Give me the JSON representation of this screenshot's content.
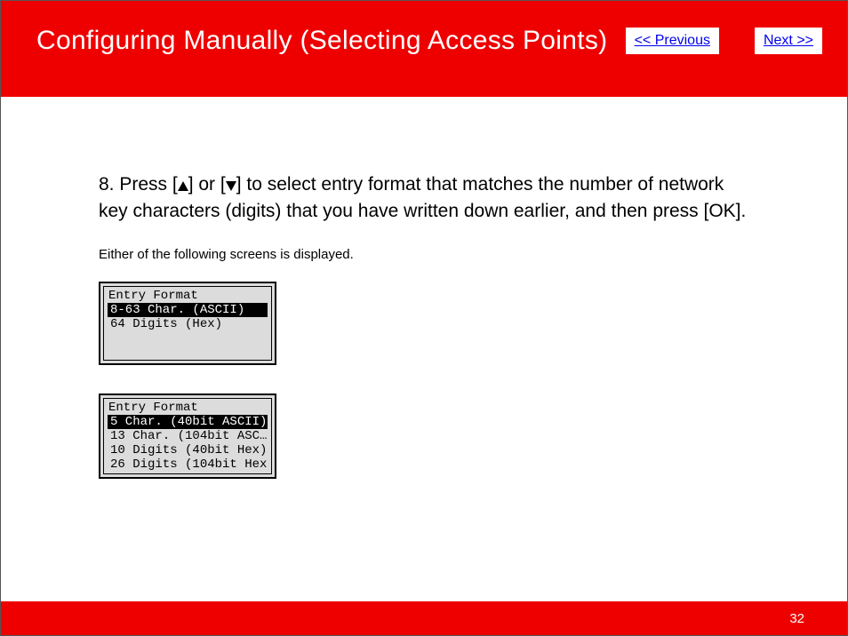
{
  "header": {
    "title": "Configuring Manually (Selecting Access Points)",
    "prev_label": "<< Previous",
    "next_label": "Next >>"
  },
  "step": {
    "number": "8.",
    "pre_arrow": " Press [",
    "mid1": "] or [",
    "mid2": "] to select entry format that matches the number of network key characters (digits) that you have written down earlier, and then press [OK]."
  },
  "note": "Either of the following screens is displayed.",
  "screens": [
    {
      "title": "Entry Format",
      "items": [
        {
          "label": "8-63 Char. (ASCII)",
          "selected": true
        },
        {
          "label": "64 Digits (Hex)",
          "selected": false
        }
      ]
    },
    {
      "title": "Entry Format",
      "items": [
        {
          "label": "5 Char. (40bit ASCII)",
          "selected": true
        },
        {
          "label": "13 Char. (104bit ASC…",
          "selected": false
        },
        {
          "label": "10 Digits (40bit Hex)",
          "selected": false
        },
        {
          "label": "26 Digits (104bit Hex)",
          "selected": false
        }
      ]
    }
  ],
  "page_number": "32"
}
